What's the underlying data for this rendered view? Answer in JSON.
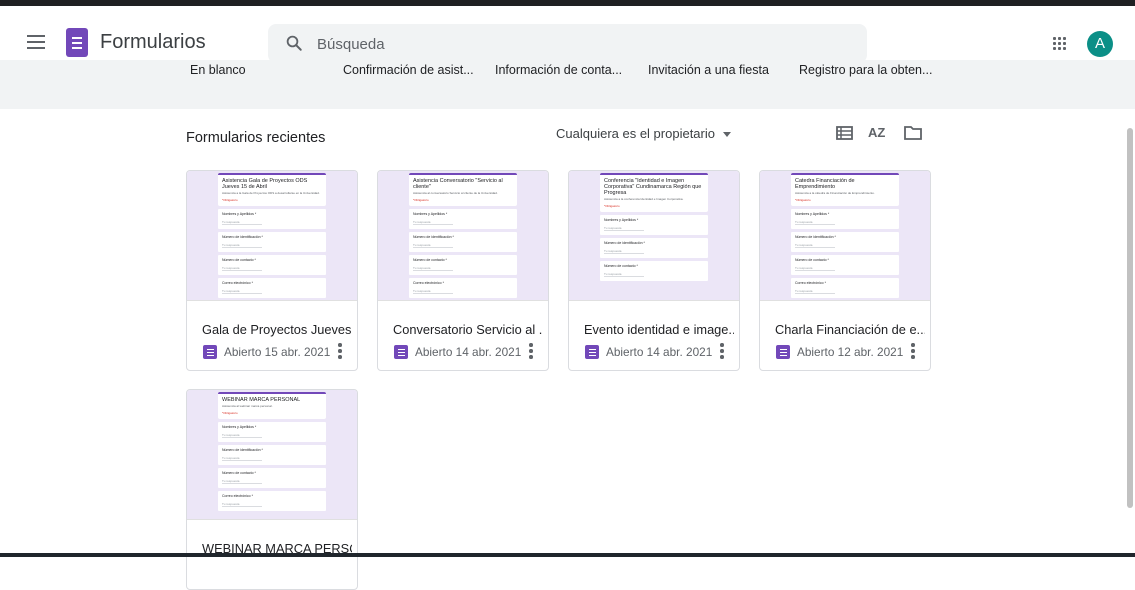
{
  "header": {
    "app_title": "Formularios",
    "search_placeholder": "Búsqueda",
    "avatar_initial": "A",
    "menu_icon": "hamburger-menu-icon",
    "apps_icon": "apps-grid-icon"
  },
  "templates": {
    "items": [
      "En blanco",
      "Confirmación de asist...",
      "Información de conta...",
      "Invitación a una fiesta",
      "Registro para la obten..."
    ]
  },
  "recent": {
    "title": "Formularios recientes",
    "owner_filter": "Cualquiera es el propietario",
    "tools": [
      "list-view-icon",
      "sort-az-icon",
      "folder-icon"
    ],
    "sort_label": "AZ"
  },
  "forms": [
    {
      "title": "Gala de Proyectos Jueves...",
      "date": "Abierto 15 abr. 2021",
      "thumb_title": "Asistencia Gala de Proyectos ODS Jueves 15 de Abril",
      "thumb_desc": "Asistencia a la Gala de Proyectos ODS a desarrollarse en la Universidad.",
      "required": "*Obligatorio",
      "questions": [
        "Nombres y Apellidos *",
        "Número de identificación *",
        "Número de contacto *",
        "Correo electrónico *"
      ],
      "answer_placeholder": "Tu respuesta"
    },
    {
      "title": "Conversatorio Servicio al ...",
      "date": "Abierto 14 abr. 2021",
      "thumb_title": "Asistencia Conversatorio \"Servicio al cliente\"",
      "thumb_desc": "Asistencia al conversatorio Servicio al cliente de la Universidad.",
      "required": "*Obligatorio",
      "questions": [
        "Nombres y Apellidos *",
        "Número de identificación *",
        "Número de contacto *",
        "Correo electrónico *"
      ],
      "answer_placeholder": "Tu respuesta"
    },
    {
      "title": "Evento identidad e image...",
      "date": "Abierto 14 abr. 2021",
      "thumb_title": "Conferencia \"Identidad e Imagen Corporativa\" Cundinamarca Región que Progresa",
      "thumb_desc": "Asistencia a la conferencia Identidad e Imagen Corporativa.",
      "required": "*Obligatorio",
      "questions": [
        "Nombres y Apellidos *",
        "Número de identificación *",
        "Número de contacto *"
      ],
      "answer_placeholder": "Tu respuesta"
    },
    {
      "title": "Charla Financiación de e...",
      "date": "Abierto 12 abr. 2021",
      "thumb_title": "Catedra Financiación de Emprendimiento",
      "thumb_desc": "Asistencia a la cátedra de Financiación de Emprendimiento.",
      "required": "*Obligatorio",
      "questions": [
        "Nombres y Apellidos *",
        "Número de identificación *",
        "Número de contacto *",
        "Correo electrónico *"
      ],
      "answer_placeholder": "Tu respuesta"
    },
    {
      "title": "WEBINAR MARCA PERSO...",
      "date": "",
      "thumb_title": "WEBINAR MARCA PERSONAL",
      "thumb_desc": "Asistencia al webinar marca personal.",
      "required": "*Obligatorio",
      "questions": [
        "Nombres y Apellidos *",
        "Número de identificación *",
        "Número de contacto *",
        "Correo electrónico *"
      ],
      "answer_placeholder": "Tu respuesta"
    }
  ]
}
